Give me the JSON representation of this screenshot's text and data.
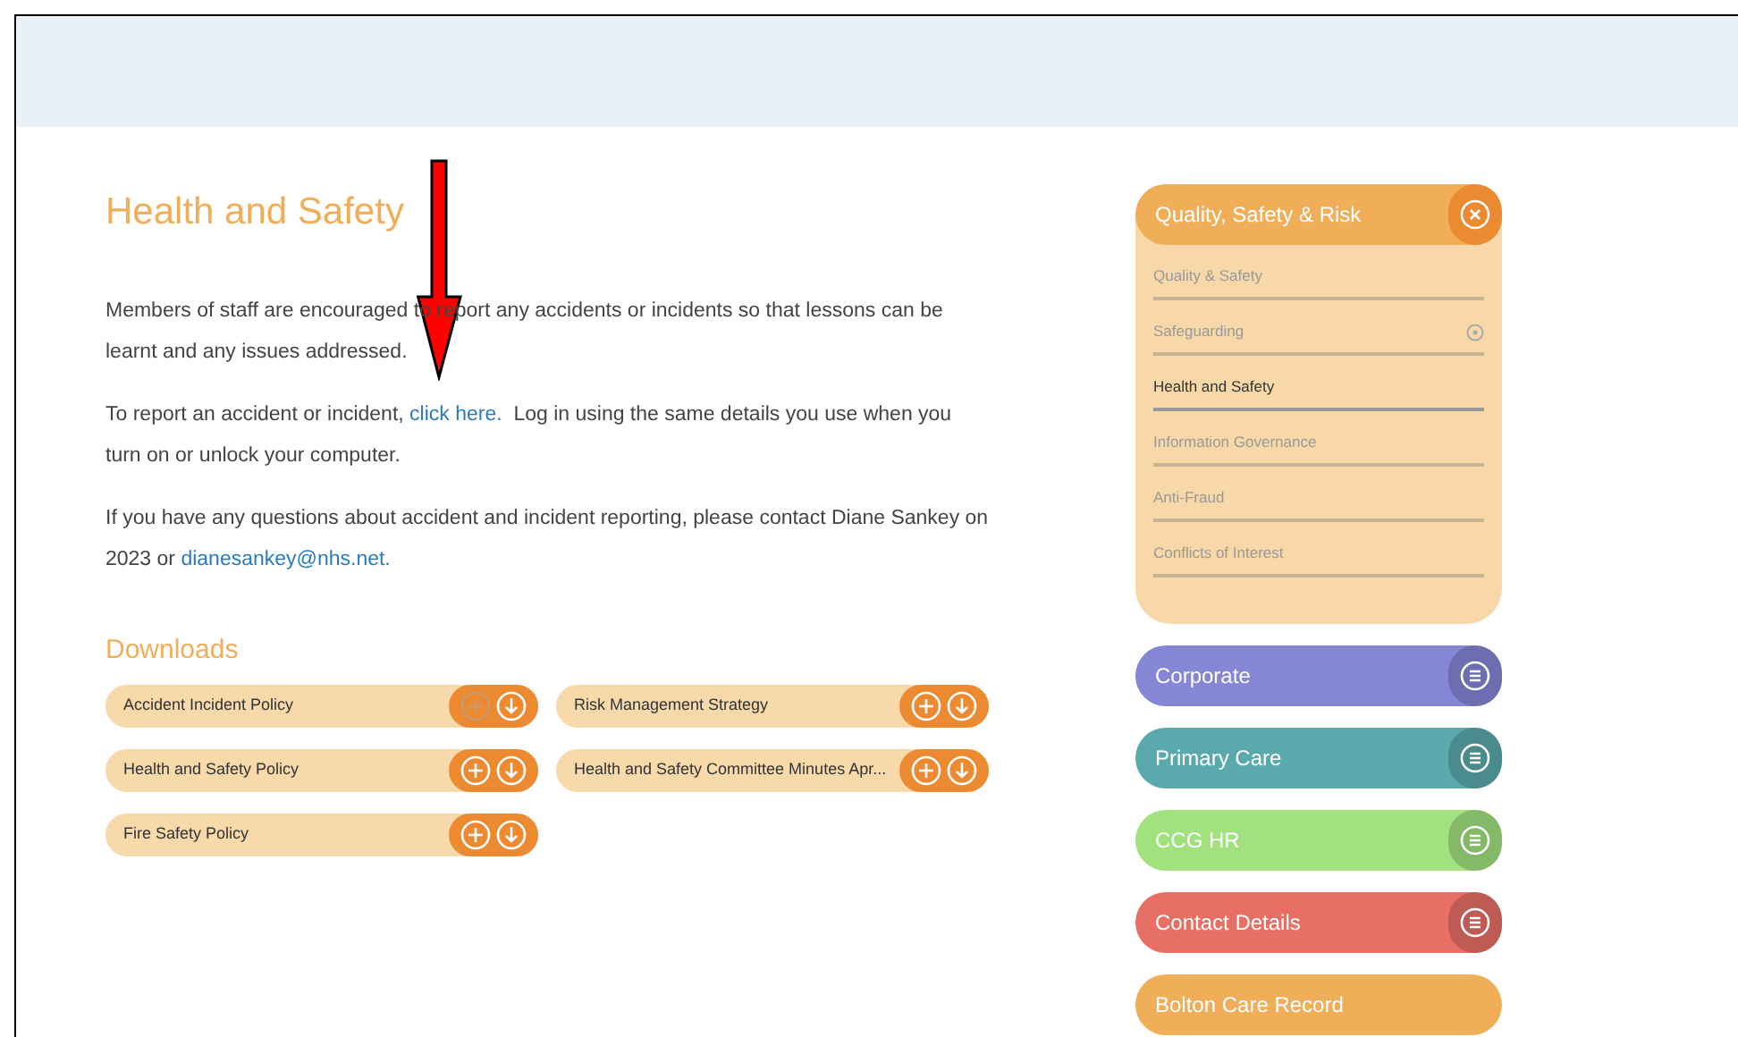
{
  "page": {
    "title": "Health and Safety",
    "paragraphs": [
      {
        "parts": [
          {
            "text": "Members of staff are encouraged to report any accidents or incidents so that lessons can be learnt and any issues addressed.",
            "link": false
          }
        ]
      },
      {
        "parts": [
          {
            "text": "To report an accident or incident, ",
            "link": false
          },
          {
            "text": "click here.",
            "link": true
          },
          {
            "text": "  Log in using the same details you use when you turn on or unlock your computer.",
            "link": false
          }
        ]
      },
      {
        "parts": [
          {
            "text": "If you have any questions about accident and incident reporting, please contact Diane Sankey on 2023 or ",
            "link": false
          },
          {
            "text": "dianesankey@nhs.net.",
            "link": true
          }
        ]
      }
    ]
  },
  "downloads": {
    "title": "Downloads",
    "items": [
      {
        "label": "Accident Incident Policy",
        "plus_disabled": true
      },
      {
        "label": "Risk Management Strategy",
        "plus_disabled": false
      },
      {
        "label": "Health and Safety Policy",
        "plus_disabled": false
      },
      {
        "label": "Health and Safety Committee Minutes Apr...",
        "plus_disabled": false
      },
      {
        "label": "Fire Safety Policy",
        "plus_disabled": false
      }
    ]
  },
  "sidebar": {
    "open_section": {
      "title": "Quality, Safety & Risk",
      "items": [
        {
          "label": "Quality & Safety",
          "selected": false,
          "has_children": false
        },
        {
          "label": "Safeguarding",
          "selected": false,
          "has_children": true
        },
        {
          "label": "Health and Safety",
          "selected": true,
          "has_children": false
        },
        {
          "label": "Information Governance",
          "selected": false,
          "has_children": false
        },
        {
          "label": "Anti-Fraud",
          "selected": false,
          "has_children": false
        },
        {
          "label": "Conflicts of Interest",
          "selected": false,
          "has_children": false
        }
      ]
    },
    "sections": [
      {
        "label": "Corporate",
        "color": "#8586d6",
        "has_menu": true
      },
      {
        "label": "Primary Care",
        "color": "#5aa9ac",
        "has_menu": true
      },
      {
        "label": "CCG HR",
        "color": "#a1e27e",
        "has_menu": true
      },
      {
        "label": "Contact Details",
        "color": "#e86f66",
        "has_menu": true
      },
      {
        "label": "Bolton Care Record",
        "color": "#f0ae59",
        "has_menu": false
      }
    ]
  },
  "annotation": {
    "kind": "arrow"
  }
}
